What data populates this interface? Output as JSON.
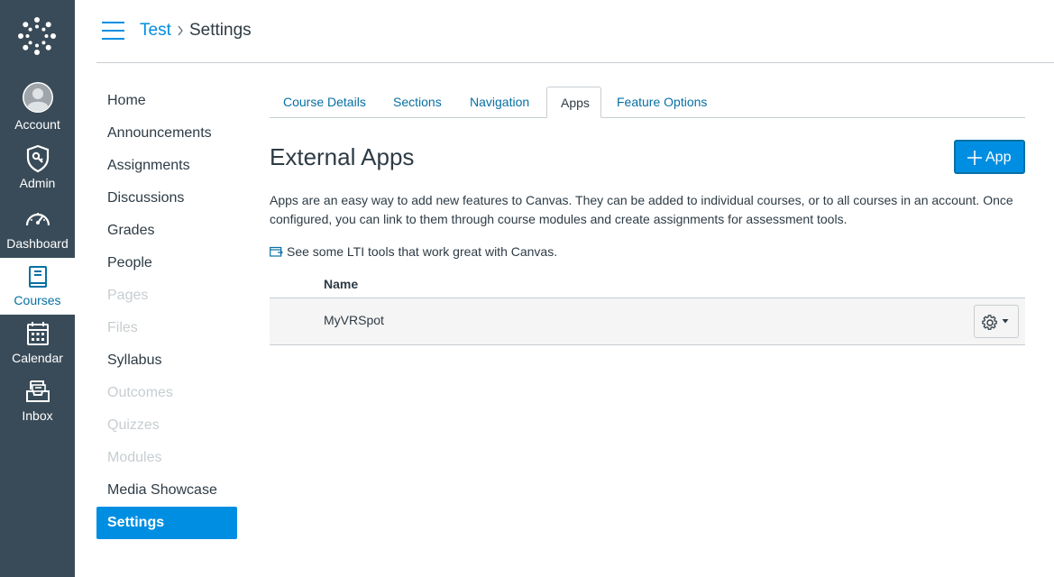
{
  "global_nav": {
    "items": [
      {
        "label": "Account",
        "icon": "avatar-icon"
      },
      {
        "label": "Admin",
        "icon": "shield-icon"
      },
      {
        "label": "Dashboard",
        "icon": "speedometer-icon"
      },
      {
        "label": "Courses",
        "icon": "book-icon",
        "active": true
      },
      {
        "label": "Calendar",
        "icon": "calendar-icon"
      },
      {
        "label": "Inbox",
        "icon": "inbox-icon"
      }
    ]
  },
  "breadcrumb": {
    "course": "Test",
    "current": "Settings"
  },
  "course_nav": {
    "items": [
      {
        "label": "Home",
        "state": "enabled"
      },
      {
        "label": "Announcements",
        "state": "enabled"
      },
      {
        "label": "Assignments",
        "state": "enabled"
      },
      {
        "label": "Discussions",
        "state": "enabled"
      },
      {
        "label": "Grades",
        "state": "enabled"
      },
      {
        "label": "People",
        "state": "enabled"
      },
      {
        "label": "Pages",
        "state": "disabled"
      },
      {
        "label": "Files",
        "state": "disabled"
      },
      {
        "label": "Syllabus",
        "state": "enabled"
      },
      {
        "label": "Outcomes",
        "state": "disabled"
      },
      {
        "label": "Quizzes",
        "state": "disabled"
      },
      {
        "label": "Modules",
        "state": "disabled"
      },
      {
        "label": "Media Showcase",
        "state": "enabled"
      },
      {
        "label": "Settings",
        "state": "active"
      }
    ]
  },
  "tabs": [
    {
      "label": "Course Details"
    },
    {
      "label": "Sections"
    },
    {
      "label": "Navigation"
    },
    {
      "label": "Apps",
      "active": true
    },
    {
      "label": "Feature Options"
    }
  ],
  "main": {
    "title": "External Apps",
    "add_button_label": "App",
    "description": "Apps are an easy way to add new features to Canvas. They can be added to individual courses, or to all courses in an account. Once configured, you can link to them through course modules and create assignments for assessment tools.",
    "lti_link": "See some LTI tools that work great with Canvas.",
    "table": {
      "header": "Name",
      "rows": [
        {
          "name": "MyVRSpot"
        }
      ]
    }
  },
  "colors": {
    "nav_bg": "#394b58",
    "brand_blue": "#008ee2",
    "link_blue": "#0770a3",
    "text": "#2d3b45",
    "disabled": "#c7cdd1"
  }
}
